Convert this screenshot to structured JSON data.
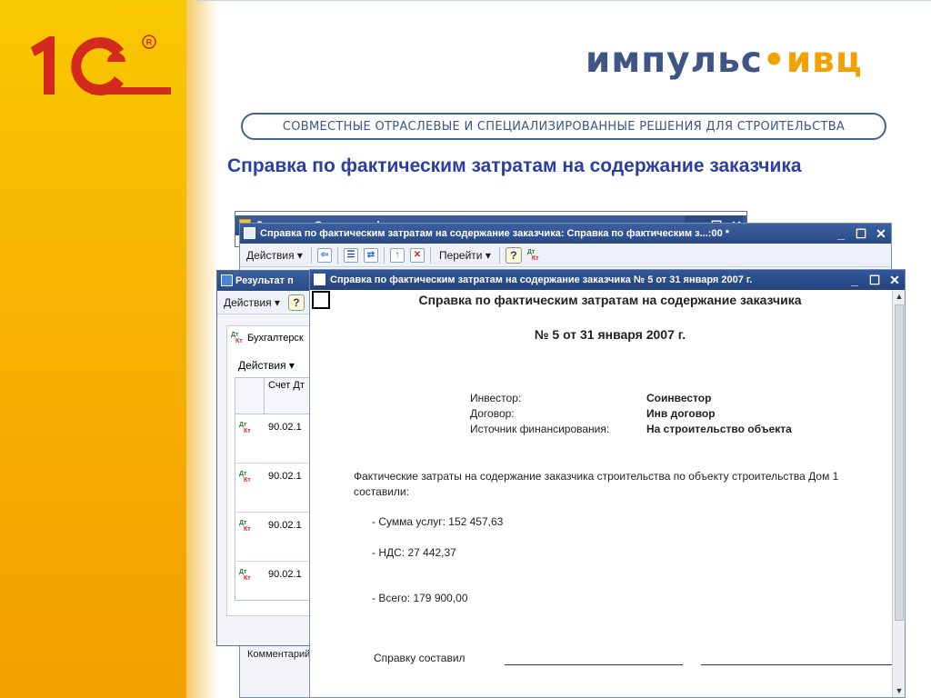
{
  "slide": {
    "brand_part1": "импульс",
    "brand_dot": "•",
    "brand_part2": "ивц",
    "tagline": "СОВМЕСТНЫЕ ОТРАСЛЕВЫЕ И СПЕЦИАЛИЗИРОВАННЫЕ РЕШЕНИЯ ДЛЯ СТРОИТЕЛЬСТВА",
    "title": "Справка по фактическим затратам на содержание заказчика",
    "colors": {
      "band": "#f7b700",
      "brand_blue": "#3e5586",
      "brand_orange": "#f2a100",
      "title_blue": "#2a3ea8"
    }
  },
  "windows": {
    "documents_list": {
      "title": "Документы Справка по фактическим затратам на содержание заказчика"
    },
    "document_form": {
      "title": "Справка по фактическим затратам на содержание заказчика: Справка по фактическим з...:00 *",
      "toolbar": {
        "actions": "Действия",
        "goto": "Перейти",
        "help": "?"
      },
      "comment_label": "Комментарий"
    },
    "result": {
      "title": "Результат п",
      "toolbar": {
        "actions": "Действия",
        "help": "?"
      },
      "tab_label": "Бухгалтерск",
      "inner_actions": "Действия",
      "column_header": "Счет Дт",
      "rows": [
        {
          "account": "90.02.1"
        },
        {
          "account": "90.02.1"
        },
        {
          "account": "90.02.1"
        },
        {
          "account": "90.02.1"
        }
      ]
    },
    "report": {
      "title": "Справка по фактическим затратам на содержание заказчика  № 5 от 31 января 2007 г.",
      "heading": "Справка по фактическим затратам на содержание заказчика",
      "number_date": "№ 5 от 31 января 2007 г.",
      "fields": [
        {
          "label": "Инвестор:",
          "value": "Соинвестор"
        },
        {
          "label": "Договор:",
          "value": "Инв договор"
        },
        {
          "label": "Источник финансирования:",
          "value": "На строительство объекта"
        }
      ],
      "intro_line1": "Фактические затраты на содержание заказчика строительства по объекту строительства Дом 1",
      "intro_line2": "составили:",
      "services": "- Сумма услуг: 152 457,63",
      "vat": "- НДС: 27 442,37",
      "total": "- Всего: 179 900,00",
      "signature_label": "Справку составил"
    }
  },
  "icons": [
    "folder-icon",
    "form-icon",
    "arrow-icon",
    "help-icon",
    "dt-kt-icon",
    "table-icon",
    "scroll-up-icon",
    "scroll-down-icon",
    "minimize-icon",
    "maximize-icon",
    "close-icon"
  ]
}
